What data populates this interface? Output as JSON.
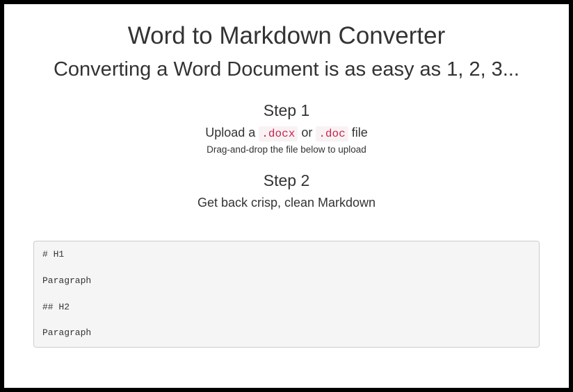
{
  "title": "Word to Markdown Converter",
  "subtitle": "Converting a Word Document is as easy as 1, 2, 3...",
  "step1": {
    "heading": "Step 1",
    "line_prefix": "Upload a ",
    "ext1": ".docx",
    "line_mid": " or ",
    "ext2": ".doc",
    "line_suffix": " file",
    "subtext": "Drag-and-drop the file below to upload"
  },
  "step2": {
    "heading": "Step 2",
    "line": "Get back crisp, clean Markdown"
  },
  "code_sample": "# H1\n\nParagraph\n\n## H2\n\nParagraph"
}
